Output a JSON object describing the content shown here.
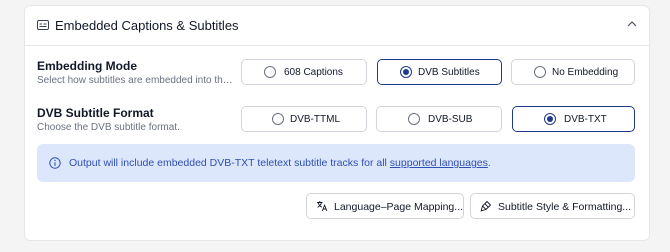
{
  "panel": {
    "title": "Embedded Captions & Subtitles",
    "header_icon": "captions-icon",
    "collapse_icon": "chevron-up-icon"
  },
  "embedding_mode": {
    "label": "Embedding Mode",
    "description": "Select how subtitles are embedded into the s...",
    "options": [
      "608 Captions",
      "DVB Subtitles",
      "No Embedding"
    ],
    "selected": "DVB Subtitles"
  },
  "dvb_format": {
    "label": "DVB Subtitle Format",
    "description": "Choose the DVB subtitle format.",
    "options": [
      "DVB-TTML",
      "DVB-SUB",
      "DVB-TXT"
    ],
    "selected": "DVB-TXT"
  },
  "info": {
    "icon": "info-icon",
    "text": "Output will include embedded DVB-TXT teletext subtitle tracks for all ",
    "link": "supported languages",
    "suffix": "."
  },
  "actions": {
    "language_mapping": {
      "label": "Language–Page Mapping...",
      "icon": "translate-icon"
    },
    "subtitle_style": {
      "label": "Subtitle Style & Formatting...",
      "icon": "paint-brush-icon"
    }
  },
  "colors": {
    "accent": "#1e3a8a",
    "info_bg": "#dde7fb",
    "info_text": "#2f4fb3"
  }
}
